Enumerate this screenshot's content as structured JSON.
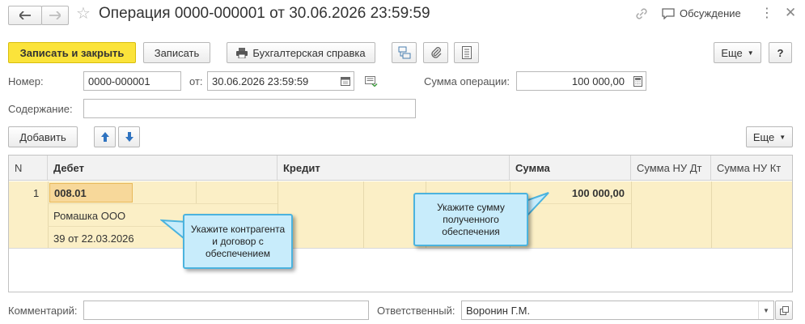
{
  "window": {
    "title": "Операция 0000-000001 от 30.06.2026 23:59:59",
    "discussion_label": "Обсуждение"
  },
  "toolbar": {
    "save_close_label": "Записать и закрыть",
    "save_label": "Записать",
    "accounting_ref_label": "Бухгалтерская справка",
    "more_label": "Еще",
    "help_label": "?"
  },
  "form": {
    "number_label": "Номер:",
    "number_value": "0000-000001",
    "date_label": "от:",
    "date_value": "30.06.2026 23:59:59",
    "sum_label": "Сумма операции:",
    "sum_value": "100 000,00",
    "content_label": "Содержание:",
    "content_value": "",
    "comment_label": "Комментарий:",
    "comment_value": "",
    "responsible_label": "Ответственный:",
    "responsible_value": "Воронин Г.М."
  },
  "table_toolbar": {
    "add_label": "Добавить",
    "more_label": "Еще"
  },
  "table": {
    "columns": [
      "N",
      "Дебет",
      "Кредит",
      "Сумма",
      "Сумма НУ Дт",
      "Сумма НУ Кт"
    ],
    "rows": [
      {
        "n": "1",
        "debit_account": "008.01",
        "debit_subconto1": "Ромашка ООО",
        "debit_subconto2": "39 от 22.03.2026",
        "amount": "100 000,00"
      }
    ]
  },
  "tooltips": {
    "counterparty": "Укажите контрагента и договор с обеспечением",
    "amount": "Укажите сумму полученного обеспечения"
  }
}
